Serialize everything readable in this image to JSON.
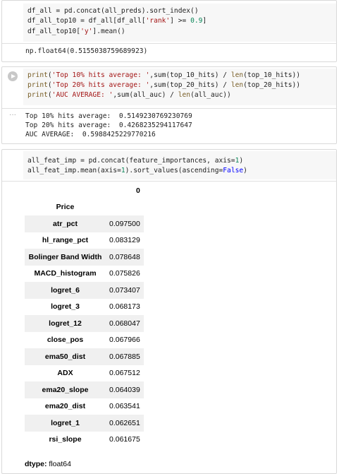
{
  "cell1": {
    "code": [
      [
        {
          "t": "df_all = pd.concat(all_preds).sort_index()"
        }
      ],
      [
        {
          "t": "df_all_top10 = df_all[df_all["
        },
        {
          "t": "'rank'",
          "c": "s-str"
        },
        {
          "t": "] >= "
        },
        {
          "t": "0.9",
          "c": "s-num"
        },
        {
          "t": "]"
        }
      ],
      [
        {
          "t": "df_all_top10["
        },
        {
          "t": "'y'",
          "c": "s-str"
        },
        {
          "t": "].mean()"
        }
      ]
    ],
    "output": "np.float64(0.5155038759689923)"
  },
  "cell2": {
    "code": [
      [
        {
          "t": "print",
          "c": "s-fn"
        },
        {
          "t": "("
        },
        {
          "t": "'Top 10% hits average: '",
          "c": "s-str"
        },
        {
          "t": ",sum(top_10_hits) / "
        },
        {
          "t": "len",
          "c": "s-fn"
        },
        {
          "t": "(top_10_hits))"
        }
      ],
      [
        {
          "t": "print",
          "c": "s-fn"
        },
        {
          "t": "("
        },
        {
          "t": "'Top 20% hits average: '",
          "c": "s-str"
        },
        {
          "t": ",sum(top_20_hits) / "
        },
        {
          "t": "len",
          "c": "s-fn"
        },
        {
          "t": "(top_20_hits))"
        }
      ],
      [
        {
          "t": "print",
          "c": "s-fn"
        },
        {
          "t": "("
        },
        {
          "t": "'AUC AVERAGE: '",
          "c": "s-str"
        },
        {
          "t": ",sum(all_auc) / "
        },
        {
          "t": "len",
          "c": "s-fn"
        },
        {
          "t": "(all_auc))"
        }
      ]
    ],
    "output": [
      "Top 10% hits average:  0.5149230769230769",
      "Top 20% hits average:  0.4268235294117647",
      "AUC AVERAGE:  0.5988425229770216"
    ]
  },
  "cell3": {
    "code": [
      [
        {
          "t": "all_feat_imp = pd.concat(feature_importances, axis="
        },
        {
          "t": "1",
          "c": "s-num"
        },
        {
          "t": ")"
        }
      ],
      [
        {
          "t": "all_feat_imp.mean(axis="
        },
        {
          "t": "1",
          "c": "s-num"
        },
        {
          "t": ").sort_values(ascending="
        },
        {
          "t": "False",
          "c": "s-kw"
        },
        {
          "t": ")"
        }
      ]
    ],
    "table": {
      "column_header": "0",
      "index_name": "Price",
      "rows": [
        {
          "label": "atr_pct",
          "value": "0.097500"
        },
        {
          "label": "hl_range_pct",
          "value": "0.083129"
        },
        {
          "label": "Bolinger Band Width",
          "value": "0.078648"
        },
        {
          "label": "MACD_histogram",
          "value": "0.075826"
        },
        {
          "label": "logret_6",
          "value": "0.073407"
        },
        {
          "label": "logret_3",
          "value": "0.068173"
        },
        {
          "label": "logret_12",
          "value": "0.068047"
        },
        {
          "label": "close_pos",
          "value": "0.067966"
        },
        {
          "label": "ema50_dist",
          "value": "0.067885"
        },
        {
          "label": "ADX",
          "value": "0.067512"
        },
        {
          "label": "ema20_slope",
          "value": "0.064039"
        },
        {
          "label": "ema20_dist",
          "value": "0.063541"
        },
        {
          "label": "logret_1",
          "value": "0.062651"
        },
        {
          "label": "rsi_slope",
          "value": "0.061675"
        }
      ]
    },
    "dtype_label": "dtype:",
    "dtype_value": "float64"
  },
  "icons": {
    "run": "play-circle-icon",
    "output_menu": "ellipsis-icon"
  }
}
